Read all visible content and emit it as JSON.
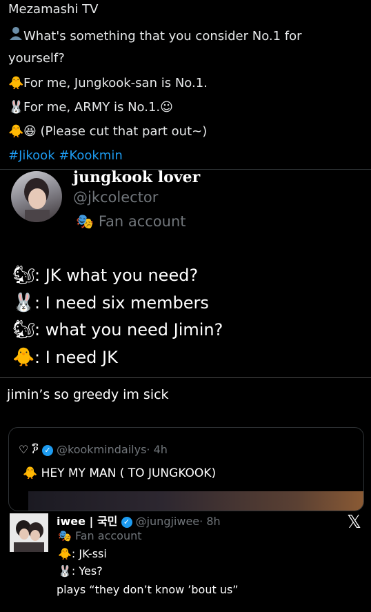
{
  "section1": {
    "title": "Mezamashi TV",
    "question": "What's something that you consider No.1 for",
    "question_cont": "yourself?",
    "line1": "For me, Jungkook-san is No.1.",
    "line2": "For me, ARMY is No.1.",
    "line3": "(Please cut that part out~)",
    "hashtags": "#Jikook #Kookmin",
    "icons": [
      "bust-icon",
      "chick-icon",
      "rabbit-icon",
      "relieved-face-icon",
      "chick-icon",
      "grinning-squint-icon"
    ]
  },
  "tweet1": {
    "name": "jungkook lover",
    "handle": "@jkcolector",
    "label": "Fan account",
    "chat": [
      {
        "icon": "chipmunk-icon",
        "text": ": JK what you need?"
      },
      {
        "icon": "rabbit-icon",
        "text": ": I need six members"
      },
      {
        "icon": "chipmunk-icon",
        "text": ": what you need Jimin?"
      },
      {
        "icon": "chick-icon",
        "text": ": I need JK"
      }
    ],
    "caption": "jimin’s so greedy im sick"
  },
  "quote": {
    "name": "♡ ዖົ",
    "handle": "@kookmindailys",
    "time": "· 4h",
    "text": "HEY MY MAN  ( TO JUNGKOOK)"
  },
  "tweet2": {
    "name": "iwee | 국민",
    "handle": "@jungjiwee",
    "time": "· 8h",
    "label": "Fan account",
    "line1": ": JK-ssi",
    "line2": ": Yes?",
    "line3": "plays “they don’t know ’bout us”"
  },
  "colors": {
    "background": "#000000",
    "link": "#1d9bf0",
    "muted": "#71767b",
    "verified": "#1d9bf0"
  }
}
